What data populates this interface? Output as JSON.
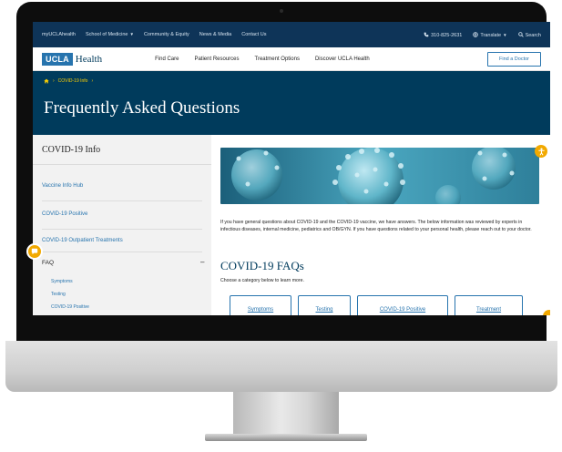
{
  "utility": {
    "items": [
      "myUCLAhealth",
      "School of Medicine",
      "Community & Equity",
      "News & Media",
      "Contact Us"
    ],
    "phone": "310-825-2631",
    "translate": "Translate",
    "search": "Search"
  },
  "nav": {
    "logo_ucla": "UCLA",
    "logo_health": "Health",
    "links": [
      "Find Care",
      "Patient Resources",
      "Treatment Options",
      "Discover UCLA Health"
    ],
    "find_doctor": "Find a Doctor"
  },
  "breadcrumb": {
    "current": "COVID-19 Info"
  },
  "page_title": "Frequently Asked Questions",
  "sidebar": {
    "title": "COVID-19 Info",
    "links": [
      "Vaccine Info Hub",
      "COVID-19 Positive",
      "COVID-19 Outpatient Treatments"
    ],
    "faq_label": "FAQ",
    "faq_toggle": "–",
    "sub_links": [
      "Symptoms",
      "Testing",
      "COVID-19 Positive"
    ]
  },
  "content": {
    "intro": "If you have general questions about COVID-19 and the COVID-19 vaccine, we have answers. The below information was reviewed by experts in infectious diseases, internal medicine, pediatrics and OB/GYN. If you have questions related to your personal health, please reach out to your doctor.",
    "faq_heading": "COVID-19 FAQs",
    "faq_subtext": "Choose a category below to learn more.",
    "categories": [
      "Symptoms",
      "Testing",
      "COVID-19 Positive",
      "Treatment"
    ]
  },
  "colors": {
    "navy": "#003b5c",
    "utility_bar": "#0e3458",
    "ucla_blue": "#2774ae",
    "gold": "#ffd100",
    "accent_orange": "#f2a900"
  },
  "icons": [
    "phone-icon",
    "globe-icon",
    "search-icon",
    "home-icon",
    "chat-icon",
    "accessibility-icon"
  ]
}
